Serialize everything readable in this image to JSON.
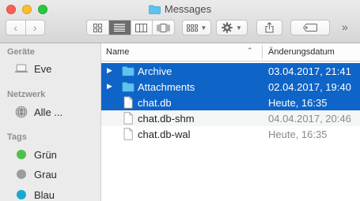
{
  "window": {
    "title": "Messages"
  },
  "toolbar": {
    "back_glyph": "‹",
    "forward_glyph": "›",
    "views": [
      "icon-view",
      "list-view",
      "column-view",
      "coverflow-view"
    ],
    "active_view": "list-view",
    "more_glyph": "»"
  },
  "sidebar": {
    "sections": {
      "favorites": "Geräte",
      "network": "Netzwerk",
      "tags": "Tags"
    },
    "devices": [
      {
        "label": "Eve",
        "icon": "laptop-icon"
      }
    ],
    "network": [
      {
        "label": "Alle ...",
        "icon": "network-globe-icon"
      }
    ],
    "tags": [
      {
        "label": "Grün",
        "color": "#4fbf4e"
      },
      {
        "label": "Grau",
        "color": "#9c9c9c"
      },
      {
        "label": "Blau",
        "color": "#17a9d1"
      }
    ]
  },
  "list": {
    "columns": {
      "name": "Name",
      "date": "Änderungsdatum"
    },
    "sort_glyph": "⌃",
    "rows": [
      {
        "name": "Archive",
        "date": "03.04.2017, 21:41",
        "kind": "folder",
        "selected": true
      },
      {
        "name": "Attachments",
        "date": "02.04.2017, 19:40",
        "kind": "folder",
        "selected": true
      },
      {
        "name": "chat.db",
        "date": "Heute, 16:35",
        "kind": "file",
        "selected": true
      },
      {
        "name": "chat.db-shm",
        "date": "04.04.2017, 20:46",
        "kind": "file",
        "selected": false
      },
      {
        "name": "chat.db-wal",
        "date": "Heute, 16:35",
        "kind": "file",
        "selected": false
      }
    ]
  },
  "colors": {
    "selection": "#0f64c7",
    "folder": "#5ec4ef"
  }
}
